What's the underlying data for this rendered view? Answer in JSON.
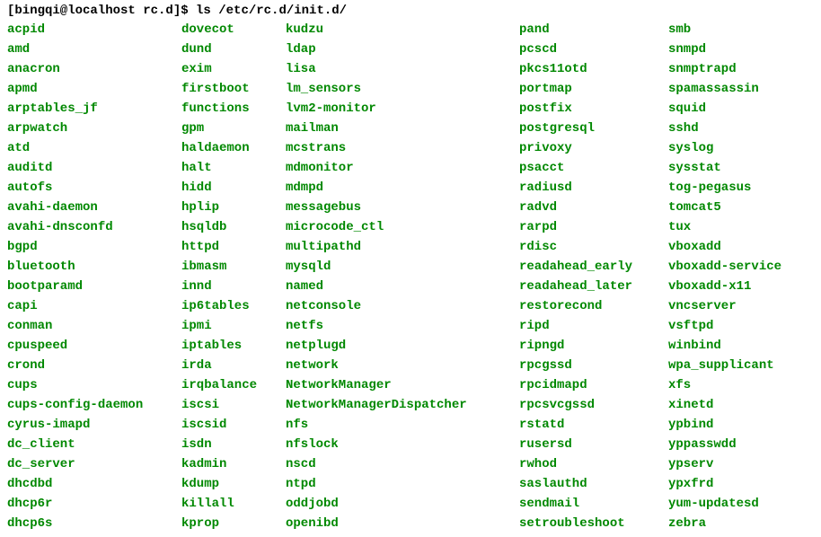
{
  "prompt": "[bingqi@localhost rc.d]$ ls /etc/rc.d/init.d/",
  "cols": [
    [
      "acpid",
      "amd",
      "anacron",
      "apmd",
      "arptables_jf",
      "arpwatch",
      "atd",
      "auditd",
      "autofs",
      "avahi-daemon",
      "avahi-dnsconfd",
      "bgpd",
      "bluetooth",
      "bootparamd",
      "capi",
      "conman",
      "cpuspeed",
      "crond",
      "cups",
      "cups-config-daemon",
      "cyrus-imapd",
      "dc_client",
      "dc_server",
      "dhcdbd",
      "dhcp6r",
      "dhcp6s"
    ],
    [
      "dovecot",
      "dund",
      "exim",
      "firstboot",
      "functions",
      "gpm",
      "haldaemon",
      "halt",
      "hidd",
      "hplip",
      "hsqldb",
      "httpd",
      "ibmasm",
      "innd",
      "ip6tables",
      "ipmi",
      "iptables",
      "irda",
      "irqbalance",
      "iscsi",
      "iscsid",
      "isdn",
      "kadmin",
      "kdump",
      "killall",
      "kprop"
    ],
    [
      "kudzu",
      "ldap",
      "lisa",
      "lm_sensors",
      "lvm2-monitor",
      "mailman",
      "mcstrans",
      "mdmonitor",
      "mdmpd",
      "messagebus",
      "microcode_ctl",
      "multipathd",
      "mysqld",
      "named",
      "netconsole",
      "netfs",
      "netplugd",
      "network",
      "NetworkManager",
      "NetworkManagerDispatcher",
      "nfs",
      "nfslock",
      "nscd",
      "ntpd",
      "oddjobd",
      "openibd"
    ],
    [
      "pand",
      "pcscd",
      "pkcs11otd",
      "portmap",
      "postfix",
      "postgresql",
      "privoxy",
      "psacct",
      "radiusd",
      "radvd",
      "rarpd",
      "rdisc",
      "readahead_early",
      "readahead_later",
      "restorecond",
      "ripd",
      "ripngd",
      "rpcgssd",
      "rpcidmapd",
      "rpcsvcgssd",
      "rstatd",
      "rusersd",
      "rwhod",
      "saslauthd",
      "sendmail",
      "setroubleshoot"
    ],
    [
      "smb",
      "snmpd",
      "snmptrapd",
      "spamassassin",
      "squid",
      "sshd",
      "syslog",
      "sysstat",
      "tog-pegasus",
      "tomcat5",
      "tux",
      "vboxadd",
      "vboxadd-service",
      "vboxadd-x11",
      "vncserver",
      "vsftpd",
      "winbind",
      "wpa_supplicant",
      "xfs",
      "xinetd",
      "ypbind",
      "yppasswdd",
      "ypserv",
      "ypxfrd",
      "yum-updatesd",
      "zebra"
    ]
  ]
}
